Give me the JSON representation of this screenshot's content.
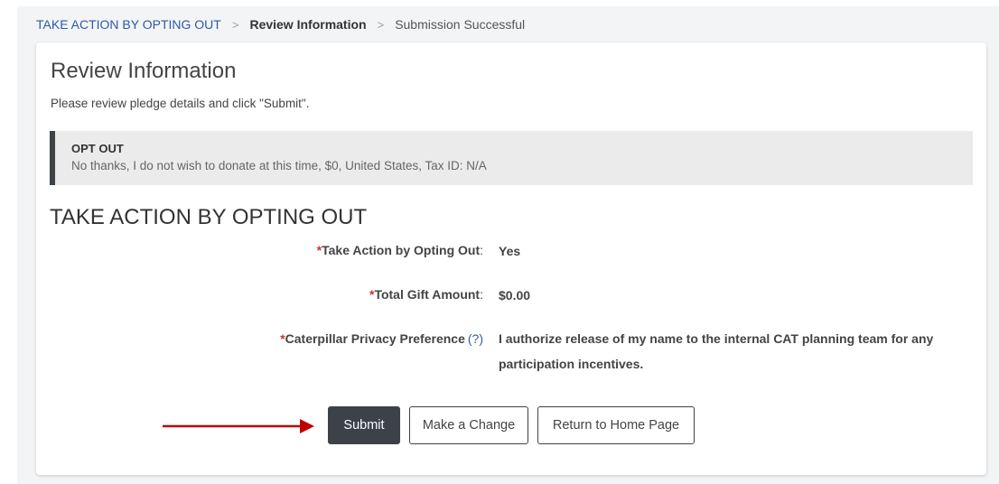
{
  "breadcrumb": {
    "step1": "TAKE ACTION BY OPTING OUT",
    "step2": "Review Information",
    "step3": "Submission Successful",
    "separator": ">"
  },
  "review": {
    "title": "Review Information",
    "description": "Please review pledge details and click \"Submit\"."
  },
  "summary": {
    "heading": "OPT OUT",
    "details": "No thanks, I do not wish to donate at this time, $0, United States, Tax ID: N/A"
  },
  "section": {
    "title": "TAKE ACTION BY OPTING OUT",
    "fields": [
      {
        "required": "*",
        "label": "Take Action by Opting Out",
        "colon": ":",
        "value": "Yes"
      },
      {
        "required": "*",
        "label": "Total Gift Amount",
        "colon": ":",
        "value": "$0.00"
      },
      {
        "required": "*",
        "label": "Caterpillar Privacy Preference",
        "help": "(?)",
        "value": "I authorize release of my name to the internal CAT planning team for any participation incentives."
      }
    ]
  },
  "buttons": {
    "submit": "Submit",
    "change": "Make a Change",
    "home": "Return to Home Page"
  },
  "colors": {
    "link": "#2e5aa8",
    "required": "#d0312d",
    "primary_button": "#3d4148",
    "arrow": "#c00000"
  },
  "annotation": {
    "icon": "arrow-right-icon"
  }
}
